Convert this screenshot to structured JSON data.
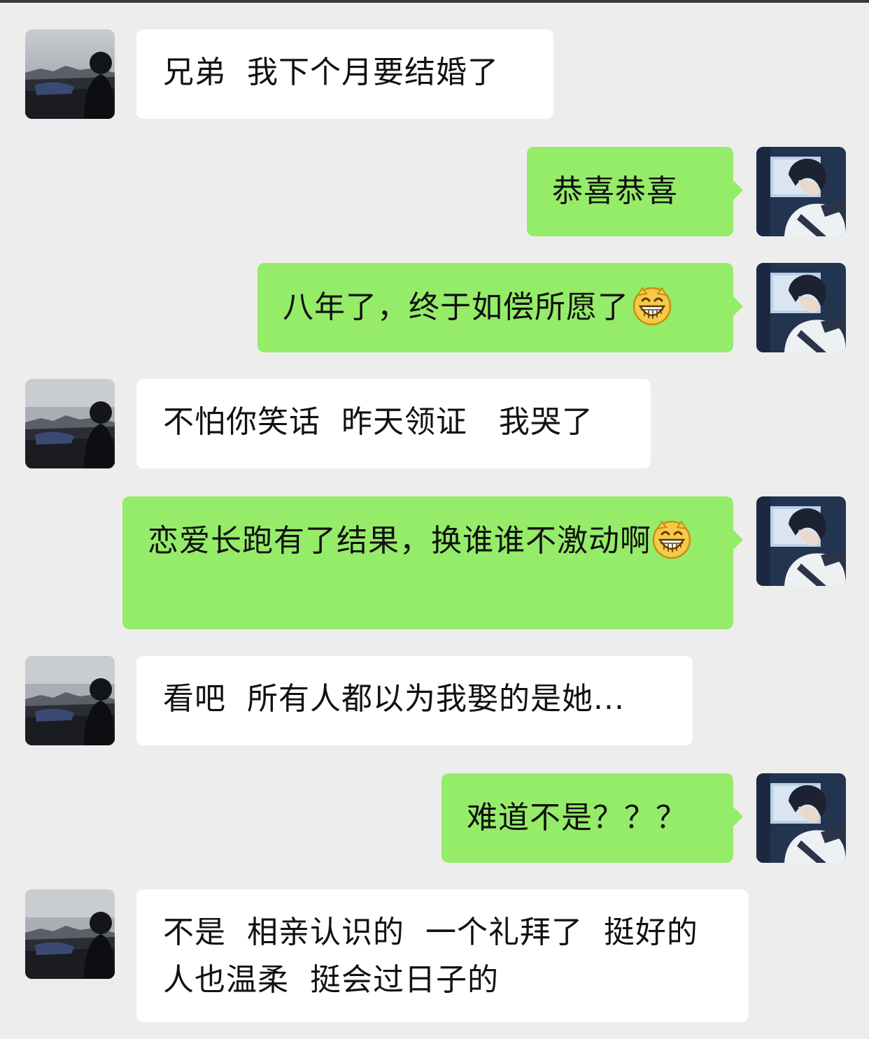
{
  "chat": {
    "messages": [
      {
        "side": "in",
        "text": "兄弟  我下个月要结婚了"
      },
      {
        "side": "out",
        "text": "恭喜恭喜"
      },
      {
        "side": "out",
        "text": "八年了，终于如偿所愿了",
        "emoji": "grinning-face-emoji"
      },
      {
        "side": "in",
        "text": "不怕你笑话  昨天领证   我哭了"
      },
      {
        "side": "out",
        "text": "恋爱长跑有了结果，换谁谁不激动啊",
        "emoji": "grinning-face-emoji"
      },
      {
        "side": "in",
        "text": "看吧  所有人都以为我娶的是她..."
      },
      {
        "side": "out",
        "text": "难道不是？？？"
      },
      {
        "side": "in",
        "text": "不是  相亲认识的  一个礼拜了  挺好的 人也温柔  挺会过日子的"
      }
    ]
  },
  "colors": {
    "background": "#ededed",
    "incoming_bubble": "#ffffff",
    "outgoing_bubble": "#95ec69"
  },
  "icons": {
    "incoming_avatar": "friend-avatar-landscape",
    "outgoing_avatar": "user-avatar-anime-boy"
  }
}
